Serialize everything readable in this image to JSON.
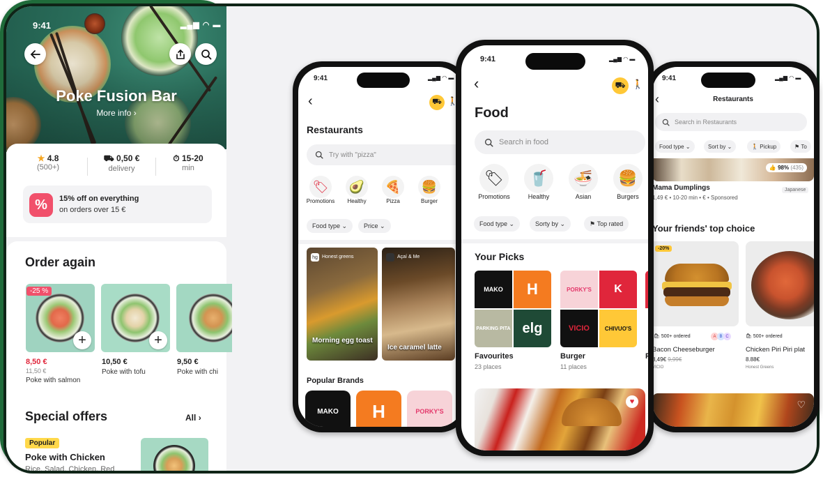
{
  "colors": {
    "brand_green": "#1f6b3a",
    "accent_yellow": "#ffc837",
    "discount_red": "#e0263b",
    "promo_pink": "#f1506b"
  },
  "phone1": {
    "status_time": "9:41",
    "restaurant_name": "Poke Fusion Bar",
    "more_info": "More info",
    "icons": {
      "back": "arrow-left-icon",
      "share": "share-icon",
      "search": "search-icon"
    },
    "stats": [
      {
        "icon": "star-icon",
        "value": "4.8",
        "sub": "(500+)"
      },
      {
        "icon": "scooter-icon",
        "value": "0,50 €",
        "sub": "delivery"
      },
      {
        "icon": "timer-icon",
        "value": "15-20",
        "sub": "min"
      }
    ],
    "promo": {
      "icon": "percent-badge-icon",
      "line1": "15% off on everything",
      "line2": "on orders over 15 €"
    },
    "order_again": {
      "title": "Order again",
      "items": [
        {
          "badge": "-25 %",
          "price": "8,50 €",
          "old_price": "11,50 €",
          "name": "Poke with salmon"
        },
        {
          "badge": "",
          "price": "10,50 €",
          "old_price": "",
          "name": "Poke with tofu"
        },
        {
          "badge": "",
          "price": "9,50 €",
          "old_price": "",
          "name": "Poke with chi"
        }
      ]
    },
    "special_offers": {
      "title": "Special offers",
      "all_label": "All",
      "tag": "Popular",
      "item_name": "Poke with Chicken",
      "item_desc": "Rice, Salad, Chicken, Red"
    }
  },
  "phone2": {
    "status_time": "9:41",
    "title": "Restaurants",
    "search_placeholder": "Try with \"pizza\"",
    "categories": [
      "Promotions",
      "Healthy",
      "Pizza",
      "Burger"
    ],
    "filters": [
      "Food type",
      "Price"
    ],
    "cards": [
      {
        "brand": "Honest greens",
        "caption": "Morning egg toast"
      },
      {
        "brand": "Açaí & Me",
        "caption": "Ice caramel latte"
      }
    ],
    "popular_brands": "Popular Brands",
    "brand_tiles": [
      "MAKO",
      "H",
      "PORKY'S"
    ]
  },
  "phone3": {
    "status_time": "9:41",
    "title": "Food",
    "search_placeholder": "Search in food",
    "categories": [
      "Promotions",
      "Healthy",
      "Asian",
      "Burgers"
    ],
    "filters": [
      "Food type",
      "Sorty by",
      "Top rated"
    ],
    "your_picks": "Your Picks",
    "picks": [
      {
        "name": "Favourites",
        "count": "23 places",
        "tiles": [
          "MAKO",
          "H",
          "PARKING PITA",
          "elg"
        ]
      },
      {
        "name": "Burger",
        "count": "11 places",
        "tiles": [
          "PORKY'S",
          "K",
          "VICIO",
          "CHIVUO'S"
        ]
      },
      {
        "name": "P",
        "count": ""
      }
    ]
  },
  "phone4": {
    "status_time": "9:41",
    "title": "Restaurants",
    "search_placeholder": "Search in Restaurants",
    "filters": [
      "Food type",
      "Sort by",
      "Pickup",
      "To"
    ],
    "featured": {
      "rating": "98%",
      "rating_count": "(435)",
      "name": "Mama Dumplings",
      "meta": "1,49 € • 10-20 min • € • Sponsored",
      "cuisine": "Japanese"
    },
    "friends_title": "Your friends' top choice",
    "items": [
      {
        "badge": "-20%",
        "ordered": "500+ ordered",
        "avatars": [
          "A",
          "B",
          "C"
        ],
        "name": "Bacon Cheeseburger",
        "price": "8,49€",
        "old_price": "9,99€",
        "vendor": "VICIO"
      },
      {
        "badge": "",
        "ordered": "500+ ordered",
        "avatars": [],
        "name": "Chicken Piri Piri plat",
        "price": "8.88€",
        "old_price": "",
        "vendor": "Honest Greens"
      }
    ]
  }
}
